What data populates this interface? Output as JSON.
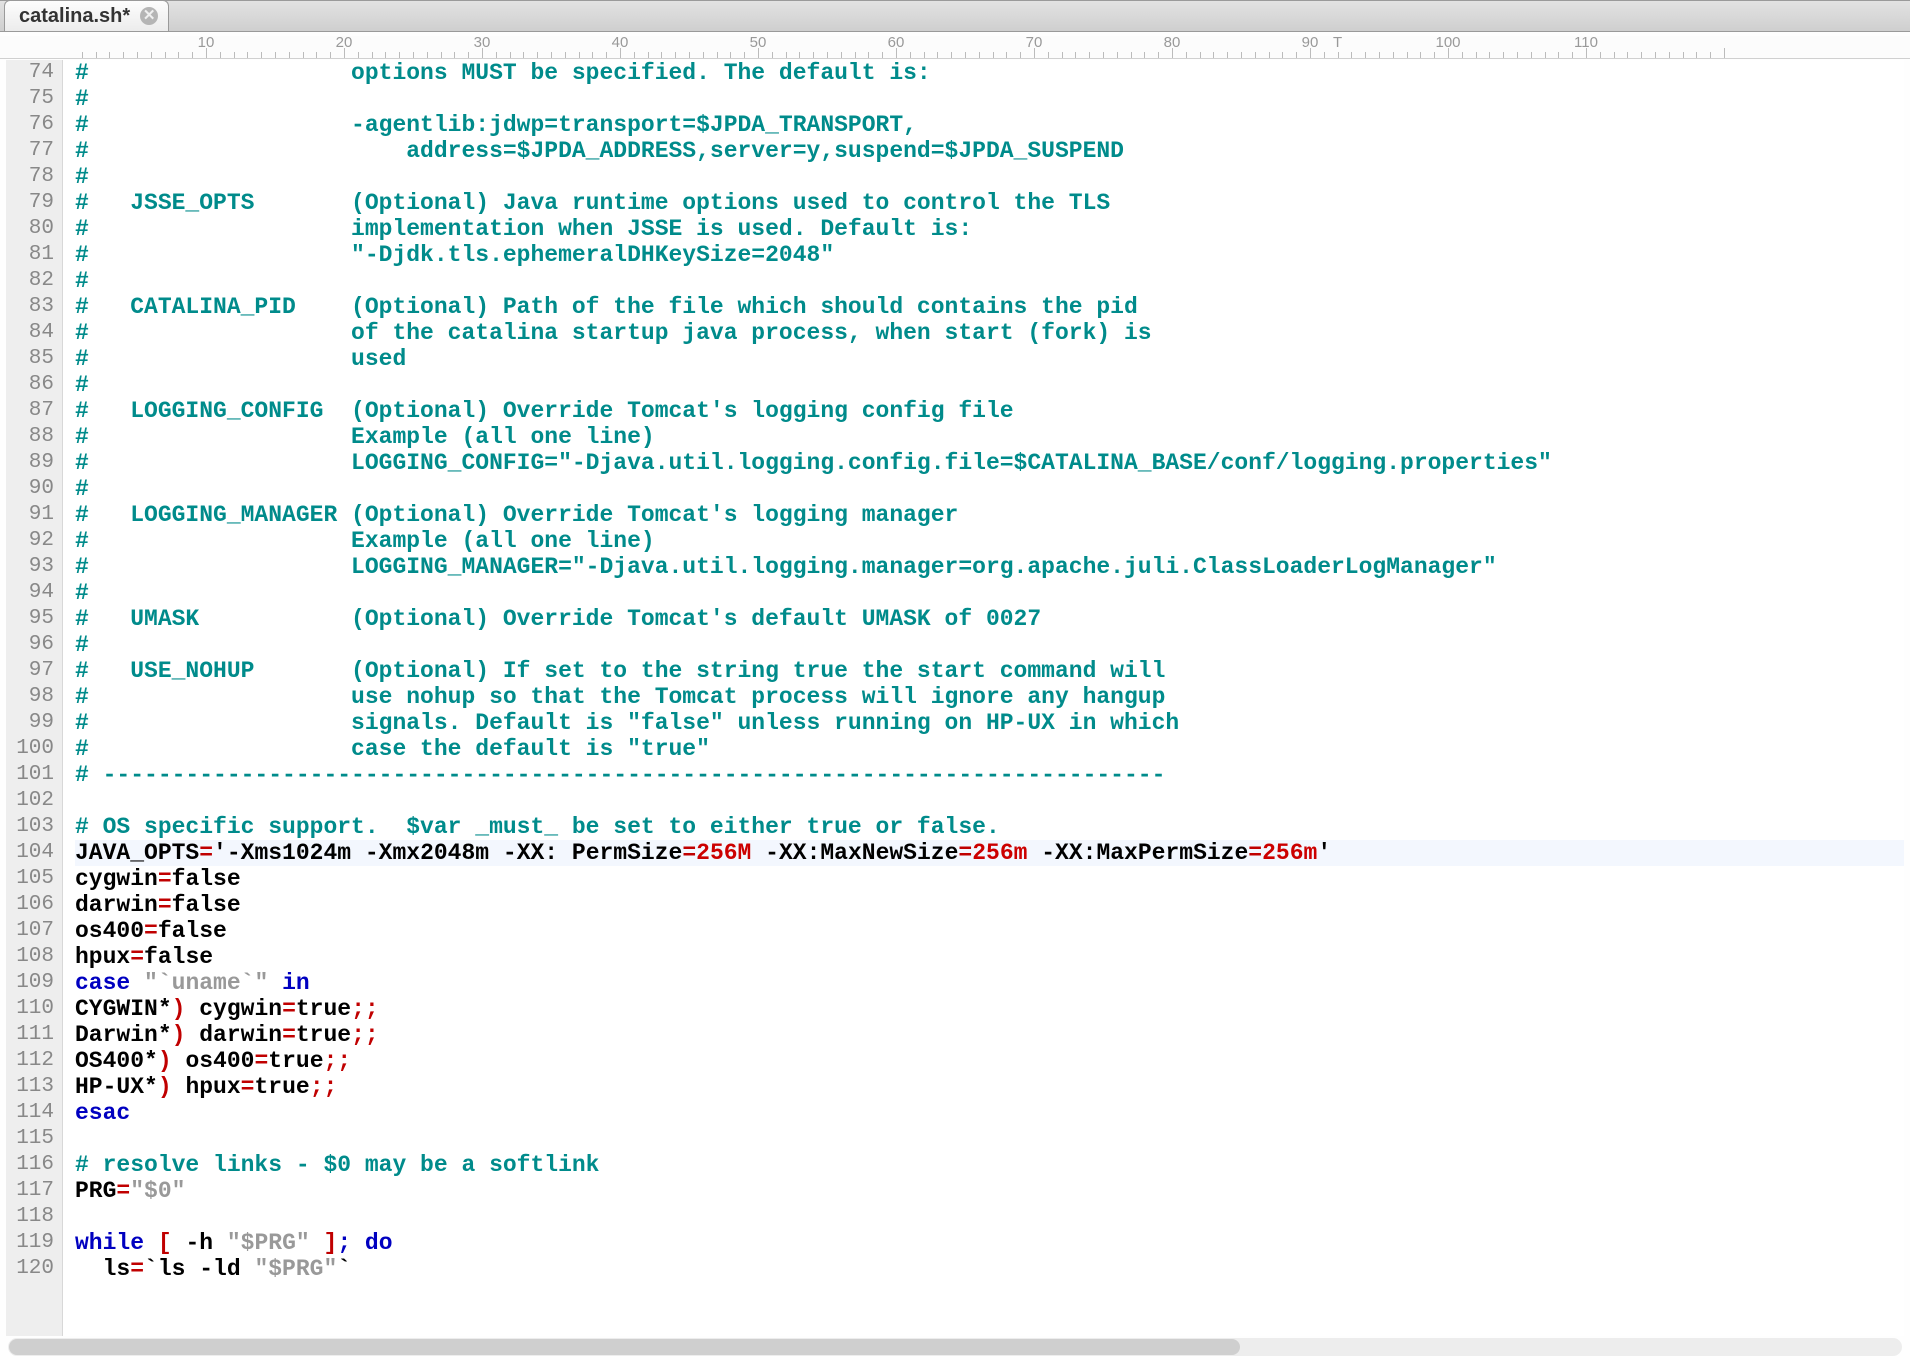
{
  "tab": {
    "title": "catalina.sh*"
  },
  "ruler": {
    "start": 10,
    "end": 110,
    "step": 10,
    "t_marker": 92
  },
  "first_line_number": 74,
  "highlighted_line_number": 104,
  "lines": [
    [
      [
        "c-comment",
        "#                   options MUST be specified. The default is:"
      ]
    ],
    [
      [
        "c-comment",
        "#"
      ]
    ],
    [
      [
        "c-comment",
        "#                   -agentlib:jdwp=transport=$JPDA_TRANSPORT,"
      ]
    ],
    [
      [
        "c-comment",
        "#                       address=$JPDA_ADDRESS,server=y,suspend=$JPDA_SUSPEND"
      ]
    ],
    [
      [
        "c-comment",
        "#"
      ]
    ],
    [
      [
        "c-comment",
        "#   JSSE_OPTS       (Optional) Java runtime options used to control the TLS"
      ]
    ],
    [
      [
        "c-comment",
        "#                   implementation when JSSE is used. Default is:"
      ]
    ],
    [
      [
        "c-comment",
        "#                   \"-Djdk.tls.ephemeralDHKeySize=2048\""
      ]
    ],
    [
      [
        "c-comment",
        "#"
      ]
    ],
    [
      [
        "c-comment",
        "#   CATALINA_PID    (Optional) Path of the file which should contains the pid"
      ]
    ],
    [
      [
        "c-comment",
        "#                   of the catalina startup java process, when start (fork) is"
      ]
    ],
    [
      [
        "c-comment",
        "#                   used"
      ]
    ],
    [
      [
        "c-comment",
        "#"
      ]
    ],
    [
      [
        "c-comment",
        "#   LOGGING_CONFIG  (Optional) Override Tomcat's logging config file"
      ]
    ],
    [
      [
        "c-comment",
        "#                   Example (all one line)"
      ]
    ],
    [
      [
        "c-comment",
        "#                   LOGGING_CONFIG=\"-Djava.util.logging.config.file=$CATALINA_BASE/conf/logging.properties\""
      ]
    ],
    [
      [
        "c-comment",
        "#"
      ]
    ],
    [
      [
        "c-comment",
        "#   LOGGING_MANAGER (Optional) Override Tomcat's logging manager"
      ]
    ],
    [
      [
        "c-comment",
        "#                   Example (all one line)"
      ]
    ],
    [
      [
        "c-comment",
        "#                   LOGGING_MANAGER=\"-Djava.util.logging.manager=org.apache.juli.ClassLoaderLogManager\""
      ]
    ],
    [
      [
        "c-comment",
        "#"
      ]
    ],
    [
      [
        "c-comment",
        "#   UMASK           (Optional) Override Tomcat's default UMASK of 0027"
      ]
    ],
    [
      [
        "c-comment",
        "#"
      ]
    ],
    [
      [
        "c-comment",
        "#   USE_NOHUP       (Optional) If set to the string true the start command will"
      ]
    ],
    [
      [
        "c-comment",
        "#                   use nohup so that the Tomcat process will ignore any hangup"
      ]
    ],
    [
      [
        "c-comment",
        "#                   signals. Default is \"false\" unless running on HP-UX in which"
      ]
    ],
    [
      [
        "c-comment",
        "#                   case the default is \"true\""
      ]
    ],
    [
      [
        "c-comment",
        "# -----------------------------------------------------------------------------"
      ]
    ],
    [
      [
        "",
        "​"
      ]
    ],
    [
      [
        "c-comment",
        "# OS specific support.  $var _must_ be set to either true or false."
      ]
    ],
    [
      [
        "c-black",
        "JAVA_OPTS"
      ],
      [
        "c-op",
        "="
      ],
      [
        "c-black",
        "'-Xms1024m -Xmx2048m -XX: PermSize"
      ],
      [
        "c-op",
        "="
      ],
      [
        "c-num",
        "256M"
      ],
      [
        "c-black",
        " -XX:MaxNewSize"
      ],
      [
        "c-op",
        "="
      ],
      [
        "c-num",
        "256m"
      ],
      [
        "c-black",
        " -XX:MaxPermSize"
      ],
      [
        "c-op",
        "="
      ],
      [
        "c-num",
        "256m"
      ],
      [
        "c-black",
        "'"
      ]
    ],
    [
      [
        "c-black",
        "cygwin"
      ],
      [
        "c-op",
        "="
      ],
      [
        "c-black",
        "false"
      ]
    ],
    [
      [
        "c-black",
        "darwin"
      ],
      [
        "c-op",
        "="
      ],
      [
        "c-black",
        "false"
      ]
    ],
    [
      [
        "c-black",
        "os400"
      ],
      [
        "c-op",
        "="
      ],
      [
        "c-black",
        "false"
      ]
    ],
    [
      [
        "c-black",
        "hpux"
      ],
      [
        "c-op",
        "="
      ],
      [
        "c-black",
        "false"
      ]
    ],
    [
      [
        "c-keyword",
        "case"
      ],
      [
        "c-black",
        " "
      ],
      [
        "c-string",
        "\"`uname`\""
      ],
      [
        "c-black",
        " "
      ],
      [
        "c-keyword",
        "in"
      ]
    ],
    [
      [
        "c-black",
        "CYGWIN*"
      ],
      [
        "c-op",
        ")"
      ],
      [
        "c-black",
        " cygwin"
      ],
      [
        "c-op",
        "="
      ],
      [
        "c-black",
        "true"
      ],
      [
        "c-op",
        ";;"
      ]
    ],
    [
      [
        "c-black",
        "Darwin*"
      ],
      [
        "c-op",
        ")"
      ],
      [
        "c-black",
        " darwin"
      ],
      [
        "c-op",
        "="
      ],
      [
        "c-black",
        "true"
      ],
      [
        "c-op",
        ";;"
      ]
    ],
    [
      [
        "c-black",
        "OS400*"
      ],
      [
        "c-op",
        ")"
      ],
      [
        "c-black",
        " os400"
      ],
      [
        "c-op",
        "="
      ],
      [
        "c-black",
        "true"
      ],
      [
        "c-op",
        ";;"
      ]
    ],
    [
      [
        "c-black",
        "HP-UX*"
      ],
      [
        "c-op",
        ")"
      ],
      [
        "c-black",
        " hpux"
      ],
      [
        "c-op",
        "="
      ],
      [
        "c-black",
        "true"
      ],
      [
        "c-op",
        ";;"
      ]
    ],
    [
      [
        "c-keyword",
        "esac"
      ]
    ],
    [
      [
        "",
        "​"
      ]
    ],
    [
      [
        "c-comment",
        "# resolve links - $0 may be a softlink"
      ]
    ],
    [
      [
        "c-black",
        "PRG"
      ],
      [
        "c-op",
        "="
      ],
      [
        "c-string",
        "\"$0\""
      ]
    ],
    [
      [
        "",
        "​"
      ]
    ],
    [
      [
        "c-keyword",
        "while"
      ],
      [
        "c-black",
        " "
      ],
      [
        "c-op",
        "["
      ],
      [
        "c-black",
        " -h "
      ],
      [
        "c-string",
        "\"$PRG\""
      ],
      [
        "c-black",
        " "
      ],
      [
        "c-op",
        "]"
      ],
      [
        "c-keyword",
        "; do"
      ]
    ],
    [
      [
        "c-black",
        "  ls"
      ],
      [
        "c-op",
        "="
      ],
      [
        "c-black",
        "`ls -ld "
      ],
      [
        "c-string",
        "\"$PRG\""
      ],
      [
        "c-black",
        "`"
      ]
    ]
  ]
}
